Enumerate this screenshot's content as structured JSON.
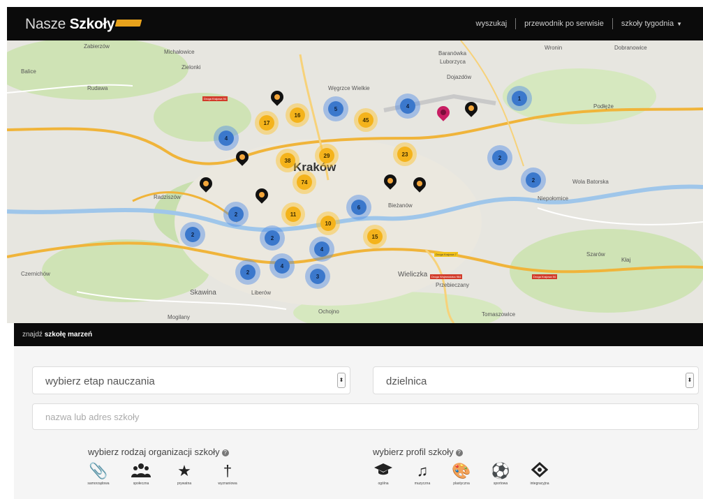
{
  "header": {
    "logo_plain": "Nasze ",
    "logo_bold": "Szkoły",
    "nav": [
      {
        "label": "wyszukaj"
      },
      {
        "label": "przewodnik po serwisie"
      },
      {
        "label": "szkoły tygodnia"
      }
    ]
  },
  "map": {
    "city": "Kraków",
    "places": [
      "Zabierzów",
      "Balice",
      "Radziszów",
      "Skawina",
      "Liberów",
      "Wieliczka",
      "Przebieczany",
      "Niepołomice",
      "Wola Batorska",
      "Baranówka",
      "Luborzyca",
      "Dojazdów",
      "Wronin",
      "Dobranowice",
      "Rudawa",
      "Zielonki",
      "Michałowice",
      "Szarów",
      "Kłaj",
      "Podłęże",
      "Węgrzce Wielkie",
      "Ochojno",
      "Mogilany",
      "Tomaszowice",
      "Bieżanów",
      "Czernichów"
    ],
    "clusters": [
      {
        "type": "blue",
        "count": "4"
      },
      {
        "type": "yellow",
        "count": "17"
      },
      {
        "type": "yellow",
        "count": "16"
      },
      {
        "type": "blue",
        "count": "5"
      },
      {
        "type": "yellow",
        "count": "45"
      },
      {
        "type": "blue",
        "count": "4"
      },
      {
        "type": "blue",
        "count": "1"
      },
      {
        "type": "yellow",
        "count": "38"
      },
      {
        "type": "yellow",
        "count": "29"
      },
      {
        "type": "yellow",
        "count": "23"
      },
      {
        "type": "blue",
        "count": "2"
      },
      {
        "type": "yellow",
        "count": "74"
      },
      {
        "type": "blue",
        "count": "2"
      },
      {
        "type": "yellow",
        "count": "11"
      },
      {
        "type": "blue",
        "count": "6"
      },
      {
        "type": "blue",
        "count": "2"
      },
      {
        "type": "yellow",
        "count": "10"
      },
      {
        "type": "blue",
        "count": "2"
      },
      {
        "type": "blue",
        "count": "2"
      },
      {
        "type": "yellow",
        "count": "15"
      },
      {
        "type": "blue",
        "count": "4"
      },
      {
        "type": "blue",
        "count": "2"
      },
      {
        "type": "blue",
        "count": "4"
      },
      {
        "type": "blue",
        "count": "3"
      }
    ],
    "road_labels": [
      "Droga Krajowa 94",
      "Droga Krajowa 7",
      "Droga Wojewódzka 964",
      "Droga Krajowa 94"
    ]
  },
  "search": {
    "title_plain": "znajdź ",
    "title_bold": "szkołę marzeń",
    "stage_select": "wybierz etap nauczania",
    "district_select": "dzielnica",
    "name_placeholder": "nazwa lub adres szkoły",
    "org_title": "wybierz rodzaj organizacji szkoły",
    "profile_title": "wybierz profil szkoły",
    "org_options": [
      {
        "label": "samorządowa",
        "icon": "paperclip-icon"
      },
      {
        "label": "społeczna",
        "icon": "people-icon"
      },
      {
        "label": "prywatna",
        "icon": "star-icon"
      },
      {
        "label": "wyznaniowa",
        "icon": "cross-icon"
      }
    ],
    "profile_options": [
      {
        "label": "ogólna",
        "icon": "graduation-cap-icon"
      },
      {
        "label": "muzyczna",
        "icon": "music-note-icon"
      },
      {
        "label": "plastyczna",
        "icon": "palette-icon"
      },
      {
        "label": "sportowa",
        "icon": "ball-icon"
      },
      {
        "label": "integracyjna",
        "icon": "integration-icon"
      }
    ]
  },
  "colors": {
    "accent": "#f4b31b",
    "cluster_blue": "#3b78cc",
    "pin_pink": "#c81e63",
    "header_bg": "#0b0b0b"
  }
}
